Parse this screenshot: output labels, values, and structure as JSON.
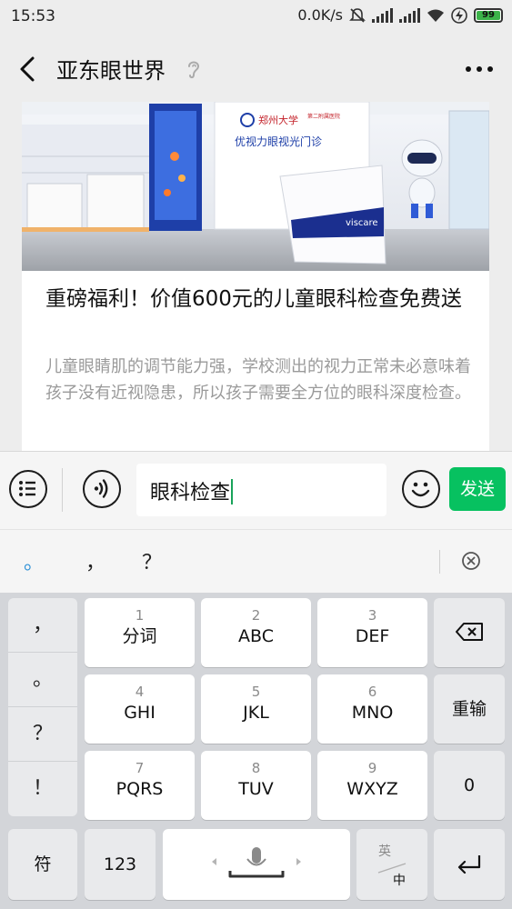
{
  "status_bar": {
    "time": "15:53",
    "net_speed": "0.0K/s",
    "battery": "99",
    "battery_color": "#3cb34a"
  },
  "nav": {
    "title": "亚东眼世界",
    "back_icon": "chevron-left-icon",
    "more_icon": "more-dots-icon"
  },
  "article": {
    "headline": "重磅福利！价值600元的儿童眼科检查免费送",
    "summary": "儿童眼睛肌的调节能力强，学校测出的视力正常未必意味着孩子没有近视隐患，所以孩子需要全方位的眼科深度检查。",
    "photo_sign_1": "郑州大学",
    "photo_sign_2": "第二附属医院",
    "photo_sign_3": "优视力眼视光门诊",
    "photo_counter_brand": "viscare"
  },
  "input": {
    "value": "眼科检查",
    "send_label": "发送",
    "send_color": "#07c160"
  },
  "candidates": [
    "。",
    "，",
    "？"
  ],
  "keyboard": {
    "left_punct": [
      "，",
      "。",
      "？",
      "！"
    ],
    "keys": [
      {
        "num": "1",
        "label": "分词"
      },
      {
        "num": "2",
        "label": "ABC"
      },
      {
        "num": "3",
        "label": "DEF"
      },
      {
        "num": "4",
        "label": "GHI"
      },
      {
        "num": "5",
        "label": "JKL"
      },
      {
        "num": "6",
        "label": "MNO"
      },
      {
        "num": "7",
        "label": "PQRS"
      },
      {
        "num": "8",
        "label": "TUV"
      },
      {
        "num": "9",
        "label": "WXYZ"
      }
    ],
    "reinput": "重输",
    "zero": "0",
    "symbol": "符",
    "numeric": "123",
    "lang_en": "英",
    "lang_zh": "中"
  }
}
